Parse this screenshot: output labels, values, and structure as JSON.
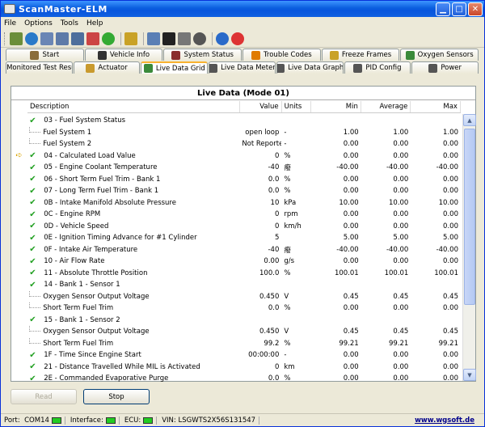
{
  "window": {
    "title": "ScanMaster-ELM"
  },
  "menu": [
    "File",
    "Options",
    "Tools",
    "Help"
  ],
  "tabs_row1": [
    {
      "label": "Start",
      "icon": "start-icon",
      "color": "#8a6d3b"
    },
    {
      "label": "Vehicle Info",
      "icon": "info-icon",
      "color": "#333333"
    },
    {
      "label": "System Status",
      "icon": "system-status-icon",
      "color": "#8a2d2d"
    },
    {
      "label": "Trouble Codes",
      "icon": "warning-icon",
      "color": "#e07b00"
    },
    {
      "label": "Freeze Frames",
      "icon": "snowflake-icon",
      "color": "#c9a227"
    },
    {
      "label": "Oxygen Sensors",
      "icon": "oxygen-sensor-icon",
      "color": "#3a8a3a"
    }
  ],
  "tabs_row2": [
    {
      "label": "Monitored Test Results",
      "icon": "test-results-icon",
      "color": "#2d6a9e",
      "active": false
    },
    {
      "label": "Actuator",
      "icon": "actuator-icon",
      "color": "#c99a2e",
      "active": false
    },
    {
      "label": "Live Data Grid",
      "icon": "grid-icon",
      "color": "#3a8a3a",
      "active": true
    },
    {
      "label": "Live Data Meter",
      "icon": "meter-icon",
      "color": "#555555",
      "active": false
    },
    {
      "label": "Live Data Graph",
      "icon": "graph-icon",
      "color": "#555555",
      "active": false
    },
    {
      "label": "PID Config",
      "icon": "pid-config-icon",
      "color": "#555555",
      "active": false
    },
    {
      "label": "Power",
      "icon": "power-icon",
      "color": "#555555",
      "active": false
    }
  ],
  "panel": {
    "title": "Live Data (Mode 01)",
    "columns": {
      "desc": "Description",
      "val": "Value",
      "units": "Units",
      "min": "Min",
      "avg": "Average",
      "max": "Max"
    }
  },
  "rows": [
    {
      "type": "header",
      "desc": "03 - Fuel System Status",
      "val": "",
      "units": "",
      "min": "",
      "avg": "",
      "max": ""
    },
    {
      "type": "child",
      "desc": "Fuel System 1",
      "val": "open loop",
      "units": "-",
      "min": "1.00",
      "avg": "1.00",
      "max": "1.00"
    },
    {
      "type": "child",
      "desc": "Fuel System 2",
      "val": "Not Reported",
      "units": "-",
      "min": "0.00",
      "avg": "0.00",
      "max": "0.00"
    },
    {
      "type": "item",
      "current": true,
      "desc": "04 - Calculated Load Value",
      "val": "0",
      "units": "%",
      "min": "0.00",
      "avg": "0.00",
      "max": "0.00"
    },
    {
      "type": "item",
      "desc": "05 - Engine Coolant Temperature",
      "val": "-40",
      "units": "癈",
      "min": "-40.00",
      "avg": "-40.00",
      "max": "-40.00"
    },
    {
      "type": "item",
      "desc": "06 - Short Term Fuel Trim - Bank 1",
      "val": "0.0",
      "units": "%",
      "min": "0.00",
      "avg": "0.00",
      "max": "0.00"
    },
    {
      "type": "item",
      "desc": "07 - Long Term Fuel Trim - Bank 1",
      "val": "0.0",
      "units": "%",
      "min": "0.00",
      "avg": "0.00",
      "max": "0.00"
    },
    {
      "type": "item",
      "desc": "0B - Intake Manifold Absolute Pressure",
      "val": "10",
      "units": "kPa",
      "min": "10.00",
      "avg": "10.00",
      "max": "10.00"
    },
    {
      "type": "item",
      "desc": "0C - Engine RPM",
      "val": "0",
      "units": "rpm",
      "min": "0.00",
      "avg": "0.00",
      "max": "0.00"
    },
    {
      "type": "item",
      "desc": "0D - Vehicle Speed",
      "val": "0",
      "units": "km/h",
      "min": "0.00",
      "avg": "0.00",
      "max": "0.00"
    },
    {
      "type": "item",
      "desc": "0E - Ignition Timing Advance for #1 Cylinder",
      "val": "5",
      "units": "",
      "min": "5.00",
      "avg": "5.00",
      "max": "5.00"
    },
    {
      "type": "item",
      "desc": "0F - Intake Air Temperature",
      "val": "-40",
      "units": "癈",
      "min": "-40.00",
      "avg": "-40.00",
      "max": "-40.00"
    },
    {
      "type": "item",
      "desc": "10 - Air Flow Rate",
      "val": "0.00",
      "units": "g/s",
      "min": "0.00",
      "avg": "0.00",
      "max": "0.00"
    },
    {
      "type": "item",
      "desc": "11 - Absolute Throttle Position",
      "val": "100.0",
      "units": "%",
      "min": "100.01",
      "avg": "100.01",
      "max": "100.01"
    },
    {
      "type": "header",
      "desc": "14 - Bank 1 - Sensor 1",
      "val": "",
      "units": "",
      "min": "",
      "avg": "",
      "max": ""
    },
    {
      "type": "child",
      "desc": "Oxygen Sensor Output Voltage",
      "val": "0.450",
      "units": "V",
      "min": "0.45",
      "avg": "0.45",
      "max": "0.45"
    },
    {
      "type": "child",
      "desc": "Short Term Fuel Trim",
      "val": "0.0",
      "units": "%",
      "min": "0.00",
      "avg": "0.00",
      "max": "0.00"
    },
    {
      "type": "header",
      "desc": "15 - Bank 1 - Sensor 2",
      "val": "",
      "units": "",
      "min": "",
      "avg": "",
      "max": ""
    },
    {
      "type": "child",
      "desc": "Oxygen Sensor Output Voltage",
      "val": "0.450",
      "units": "V",
      "min": "0.45",
      "avg": "0.45",
      "max": "0.45"
    },
    {
      "type": "child",
      "desc": "Short Term Fuel Trim",
      "val": "99.2",
      "units": "%",
      "min": "99.21",
      "avg": "99.21",
      "max": "99.21"
    },
    {
      "type": "item",
      "desc": "1F - Time Since Engine Start",
      "val": "00:00:00",
      "units": "-",
      "min": "0.00",
      "avg": "0.00",
      "max": "0.00"
    },
    {
      "type": "item",
      "desc": "21 - Distance Travelled While MIL is Activated",
      "val": "0",
      "units": "km",
      "min": "0.00",
      "avg": "0.00",
      "max": "0.00"
    },
    {
      "type": "item",
      "desc": "2E - Commanded Evaporative Purge",
      "val": "0.0",
      "units": "%",
      "min": "0.00",
      "avg": "0.00",
      "max": "0.00"
    }
  ],
  "buttons": {
    "read": "Read",
    "stop": "Stop"
  },
  "status": {
    "port_label": "Port:",
    "port_value": "COM14",
    "interface_label": "Interface:",
    "ecu_label": "ECU:",
    "vin": "VIN: LSGWTS2X56S131547",
    "website": "www.wgsoft.de",
    "led_color": "#22cc22"
  }
}
